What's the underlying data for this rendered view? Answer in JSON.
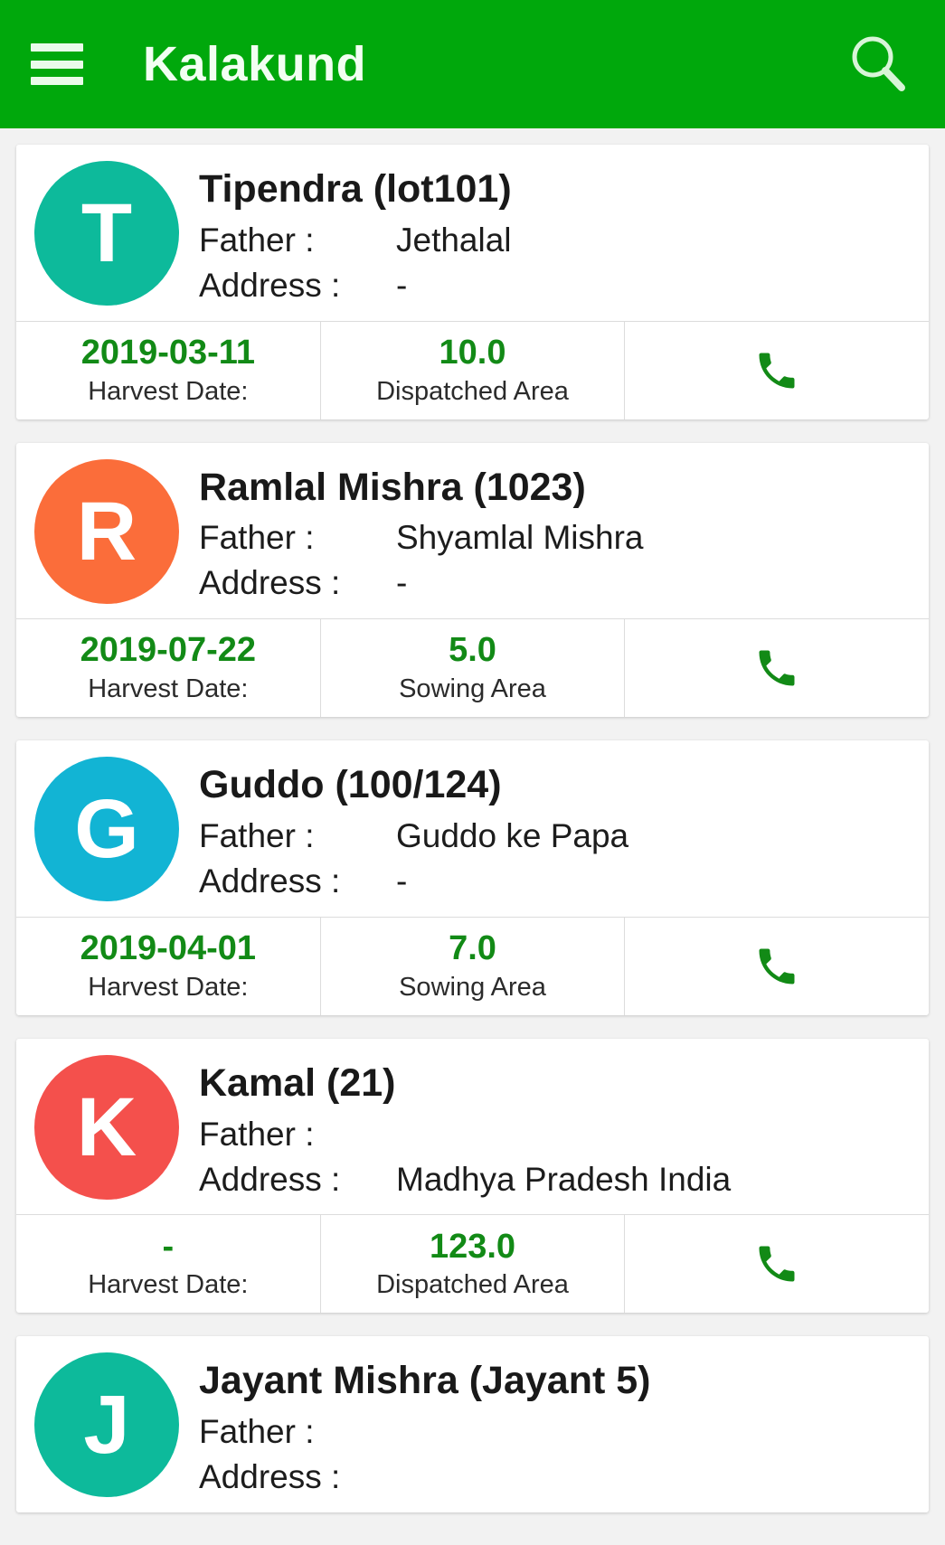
{
  "header": {
    "title": "Kalakund",
    "menu_icon": "hamburger-menu-icon",
    "search_icon": "search-icon",
    "background_color": "#00a80c"
  },
  "labels": {
    "father": "Father :",
    "address": "Address :",
    "harvest_date": "Harvest Date:",
    "call_icon": "phone-icon"
  },
  "cards": [
    {
      "initial": "T",
      "avatar_color": "#0dba9b",
      "name": "Tipendra (lot101)",
      "father": "Jethalal",
      "address": "-",
      "harvest_date": "2019-03-11",
      "area_value": "10.0",
      "area_label": "Dispatched Area"
    },
    {
      "initial": "R",
      "avatar_color": "#fb6d3a",
      "name": "Ramlal Mishra (1023)",
      "father": "Shyamlal Mishra",
      "address": "-",
      "harvest_date": "2019-07-22",
      "area_value": "5.0",
      "area_label": "Sowing Area"
    },
    {
      "initial": "G",
      "avatar_color": "#12b4d4",
      "name": "Guddo (100/124)",
      "father": "Guddo ke Papa",
      "address": "-",
      "harvest_date": "2019-04-01",
      "area_value": "7.0",
      "area_label": "Sowing Area"
    },
    {
      "initial": "K",
      "avatar_color": "#f4504c",
      "name": "Kamal (21)",
      "father": "",
      "address": "Madhya Pradesh India",
      "harvest_date": "-",
      "area_value": "123.0",
      "area_label": "Dispatched Area"
    },
    {
      "initial": "J",
      "avatar_color": "#0dba9b",
      "name": "Jayant Mishra (Jayant 5)",
      "father": "",
      "address": "",
      "harvest_date": "",
      "area_value": "",
      "area_label": ""
    }
  ]
}
